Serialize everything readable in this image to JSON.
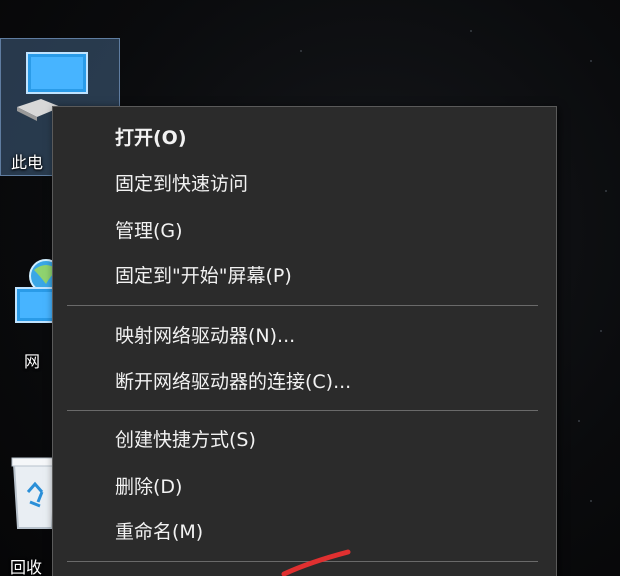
{
  "desktop": {
    "icons": [
      {
        "label": "此电",
        "icon": "this-pc-icon"
      },
      {
        "label": "网",
        "icon": "network-icon"
      },
      {
        "label": "回收",
        "icon": "recycle-bin-icon"
      }
    ]
  },
  "context_menu": {
    "items": [
      {
        "label": "打开(O)",
        "bold": true
      },
      {
        "label": "固定到快速访问"
      },
      {
        "label": "管理(G)"
      },
      {
        "label": "固定到\"开始\"屏幕(P)"
      },
      {
        "label": "映射网络驱动器(N)..."
      },
      {
        "label": "断开网络驱动器的连接(C)..."
      },
      {
        "label": "创建快捷方式(S)"
      },
      {
        "label": "删除(D)"
      },
      {
        "label": "重命名(M)"
      }
    ]
  },
  "colors": {
    "menu_bg": "#2b2b2b",
    "menu_text": "#f2f2f2",
    "separator": "#6a6a6a",
    "selection": "#6496c8",
    "annotation_red": "#e03030"
  }
}
